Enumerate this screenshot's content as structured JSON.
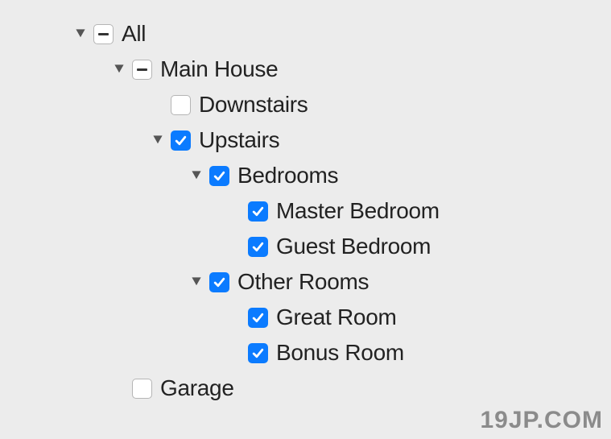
{
  "tree": {
    "all": {
      "label": "All",
      "state": "mixed",
      "expanded": true
    },
    "main_house": {
      "label": "Main House",
      "state": "mixed",
      "expanded": true
    },
    "downstairs": {
      "label": "Downstairs",
      "state": "unchecked",
      "expanded": false
    },
    "upstairs": {
      "label": "Upstairs",
      "state": "checked",
      "expanded": true
    },
    "bedrooms": {
      "label": "Bedrooms",
      "state": "checked",
      "expanded": true
    },
    "master_bedroom": {
      "label": "Master Bedroom",
      "state": "checked",
      "expanded": false
    },
    "guest_bedroom": {
      "label": "Guest Bedroom",
      "state": "checked",
      "expanded": false
    },
    "other_rooms": {
      "label": "Other Rooms",
      "state": "checked",
      "expanded": true
    },
    "great_room": {
      "label": "Great Room",
      "state": "checked",
      "expanded": false
    },
    "bonus_room": {
      "label": "Bonus Room",
      "state": "checked",
      "expanded": false
    },
    "garage": {
      "label": "Garage",
      "state": "unchecked",
      "expanded": false
    }
  },
  "watermark": "19JP.COM"
}
